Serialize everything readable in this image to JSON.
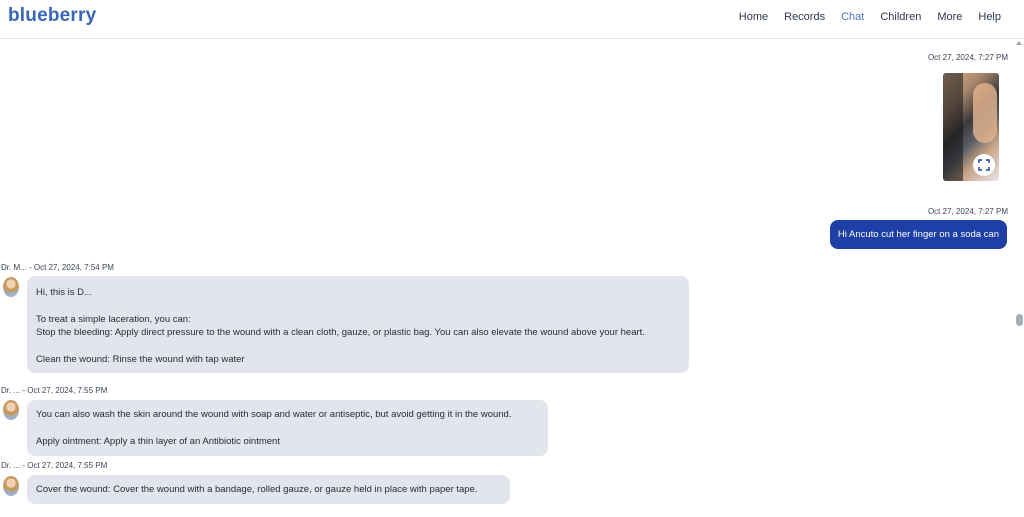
{
  "app": {
    "logo": "blueberry"
  },
  "nav": {
    "items": [
      {
        "label": "Home"
      },
      {
        "label": "Records"
      },
      {
        "label": "Chat"
      },
      {
        "label": "Children"
      },
      {
        "label": "More"
      },
      {
        "label": "Help"
      }
    ],
    "active": "Chat",
    "active_color": "#4a73c2"
  },
  "colors": {
    "brand": "#3a66b8",
    "user_bubble": "#1d3fa6",
    "doctor_bubble": "#e2e5ec"
  },
  "chat": {
    "user_messages": [
      {
        "timestamp": "Oct 27, 2024, 7:27 PM",
        "type": "image",
        "action_icon": "expand-icon"
      },
      {
        "timestamp": "Oct 27, 2024, 7:27 PM",
        "text": "Hi Ancuto cut her finger on a soda can"
      }
    ],
    "doctor_messages": [
      {
        "sender": "Dr. M...",
        "timestamp": "- Oct 27, 2024, 7:54 PM",
        "lines": [
          "Hi, this is D...",
          "",
          "To treat a simple laceration, you can:",
          "Stop the bleeding: Apply direct pressure to the wound with a clean cloth, gauze, or plastic bag. You can also elevate the wound above your heart.",
          "",
          "Clean the wound: Rinse the wound with tap water"
        ]
      },
      {
        "sender": "Dr. ...",
        "timestamp": "- Oct 27, 2024, 7:55 PM",
        "lines": [
          "You can also wash the skin around the wound with soap and water or antiseptic, but avoid getting it in the wound.",
          "",
          "Apply ointment: Apply a thin layer of an Antibiotic ointment"
        ]
      },
      {
        "sender": "Dr. ...",
        "timestamp": "- Oct 27, 2024, 7:55 PM",
        "lines": [
          "Cover the wound: Cover the wound with a bandage, rolled gauze, or gauze held in place with paper tape."
        ]
      }
    ]
  }
}
